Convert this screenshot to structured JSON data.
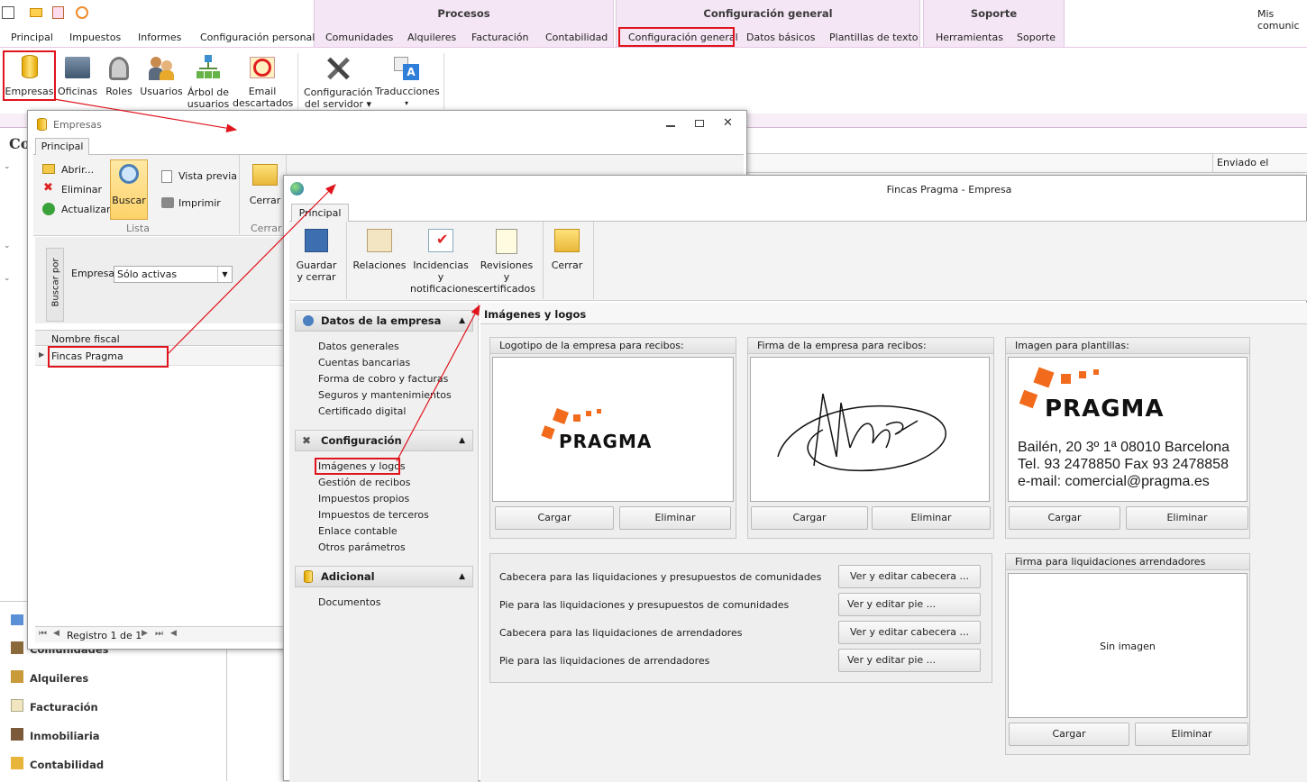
{
  "top": {
    "context_groups": [
      "Procesos",
      "Configuración general",
      "Soporte"
    ],
    "right_text": "Mis comunic",
    "tabs": [
      "Principal",
      "Impuestos",
      "Informes",
      "Configuración personal",
      "Comunidades",
      "Alquileres",
      "Facturación",
      "Contabilidad",
      "Configuración general",
      "Datos básicos",
      "Plantillas de texto",
      "Herramientas",
      "Soporte"
    ]
  },
  "ribbon": {
    "buttons": [
      "Empresas",
      "Oficinas",
      "Roles",
      "Usuarios",
      "Árbol de usuarios",
      "Email descartados",
      "Configuración del servidor",
      "Traducciones"
    ],
    "b5a": "Árbol de",
    "b5b": "usuarios",
    "b6a": "Email",
    "b6b": "descartados",
    "b7a": "Configuración",
    "b7b": "del servidor ▾",
    "b8": "Traducciones",
    "b8c": "▾"
  },
  "background": {
    "title": "Co",
    "col_enviado": "Enviado el",
    "nav": [
      "Comunidades",
      "Alquileres",
      "Facturación",
      "Inmobiliaria",
      "Contabilidad"
    ]
  },
  "empresas_window": {
    "title": "Empresas",
    "tab": "Principal",
    "abrir": "Abrir...",
    "eliminar": "Eliminar",
    "actualizar": "Actualizar",
    "buscar": "Buscar",
    "vista_previa": "Vista previa",
    "imprimir": "Imprimir",
    "cerrar": "Cerrar",
    "grp_lista": "Lista",
    "grp_cerrar": "Cerrar",
    "buscar_por": "Buscar por",
    "empresa_label": "Empresa:",
    "empresa_value": "Sólo activas",
    "col_nombre": "Nombre fiscal",
    "row1": "Fincas Pragma",
    "registro": "Registro 1 de 1"
  },
  "fincas_window": {
    "title": "Fincas Pragma - Empresa",
    "tab": "Principal",
    "tb": {
      "guardar1": "Guardar",
      "guardar2": "y cerrar",
      "relaciones": "Relaciones",
      "inc1": "Incidencias y",
      "inc2": "notificaciones",
      "rev1": "Revisiones y",
      "rev2": "certificados",
      "cerrar": "Cerrar"
    },
    "sec1": {
      "title": "Datos de la empresa",
      "items": [
        "Datos generales",
        "Cuentas bancarias",
        "Forma de cobro y facturas",
        "Seguros y mantenimientos",
        "Certificado digital"
      ]
    },
    "sec2": {
      "title": "Configuración",
      "items": [
        "Imágenes y logos",
        "Gestión de recibos",
        "Impuestos propios",
        "Impuestos de terceros",
        "Enlace contable",
        "Otros parámetros"
      ]
    },
    "sec3": {
      "title": "Adicional",
      "items": [
        "Documentos"
      ]
    },
    "content_title": "Imágenes y logos",
    "logo_box": {
      "title": "Logotipo de la empresa para recibos:",
      "cargar": "Cargar",
      "eliminar": "Eliminar"
    },
    "firma_box": {
      "title": "Firma de la empresa para recibos:",
      "cargar": "Cargar",
      "eliminar": "Eliminar"
    },
    "plantillas_box": {
      "title": "Imagen para plantillas:",
      "cargar": "Cargar",
      "eliminar": "Eliminar",
      "line1": "Bailén, 20 3º 1ª 08010 Barcelona",
      "line2": "Tel. 93 2478850 Fax 93 2478858",
      "line3": "e-mail: comercial@pragma.es"
    },
    "brand": "PRAGMA",
    "rows": [
      {
        "label": "Cabecera para las liquidaciones y presupuestos de comunidades",
        "btn": "Ver y editar cabecera ..."
      },
      {
        "label": "Pie para las liquidaciones y presupuestos de comunidades",
        "btn": "Ver y editar pie ..."
      },
      {
        "label": "Cabecera para las liquidaciones de arrendadores",
        "btn": "Ver y editar cabecera ..."
      },
      {
        "label": "Pie para las liquidaciones de arrendadores",
        "btn": "Ver y editar pie ..."
      }
    ],
    "firma_liq": {
      "title": "Firma para liquidaciones arrendadores",
      "empty": "Sin imagen",
      "cargar": "Cargar",
      "eliminar": "Eliminar"
    }
  },
  "colors": {
    "accent_red": "#e0141c",
    "context_tab": "#f5e6f5",
    "pragma_orange": "#f26b1d"
  }
}
